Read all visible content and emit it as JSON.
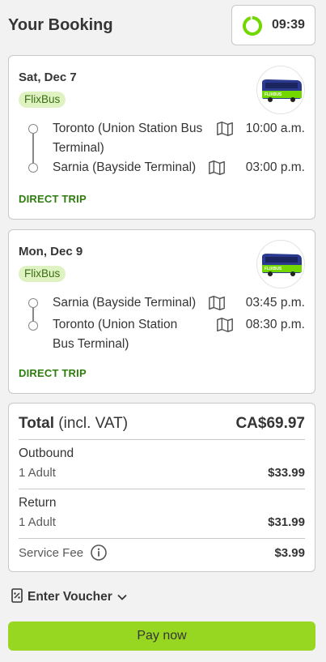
{
  "header": {
    "title": "Your Booking",
    "timer": "09:39"
  },
  "trips": [
    {
      "date": "Sat, Dec 7",
      "brand": "FlixBus",
      "logo_text": "FLIXBUS",
      "from_station": "Toronto (Union Station Bus Terminal)",
      "from_time": "10:00 a.m.",
      "to_station": "Sarnia (Bayside Terminal)",
      "to_time": "03:00 p.m.",
      "type": "DIRECT TRIP"
    },
    {
      "date": "Mon, Dec 9",
      "brand": "FlixBus",
      "logo_text": "FLIXBUS",
      "from_station": "Sarnia (Bayside Terminal)",
      "from_time": "03:45 p.m.",
      "to_station": "Toronto (Union Station Bus Terminal)",
      "to_time": "08:30 p.m.",
      "type": "DIRECT TRIP"
    }
  ],
  "summary": {
    "total_label": "Total",
    "total_suffix": "(incl. VAT)",
    "total_value": "CA$69.97",
    "outbound_label": "Outbound",
    "outbound_sub": "1 Adult",
    "outbound_value": "$33.99",
    "return_label": "Return",
    "return_sub": "1 Adult",
    "return_value": "$31.99",
    "fee_label": "Service Fee",
    "fee_value": "$3.99"
  },
  "voucher": {
    "label": "Enter Voucher"
  },
  "pay": {
    "label": "Pay now"
  },
  "colors": {
    "accent": "#97d721",
    "brand_green": "#73d700",
    "direct_trip": "#2f7d0e",
    "badge_bg": "#dff3c2"
  },
  "icons": [
    "timer-ring-icon",
    "bus-logo-icon",
    "map-icon",
    "info-icon",
    "voucher-icon",
    "chevron-down-icon"
  ]
}
